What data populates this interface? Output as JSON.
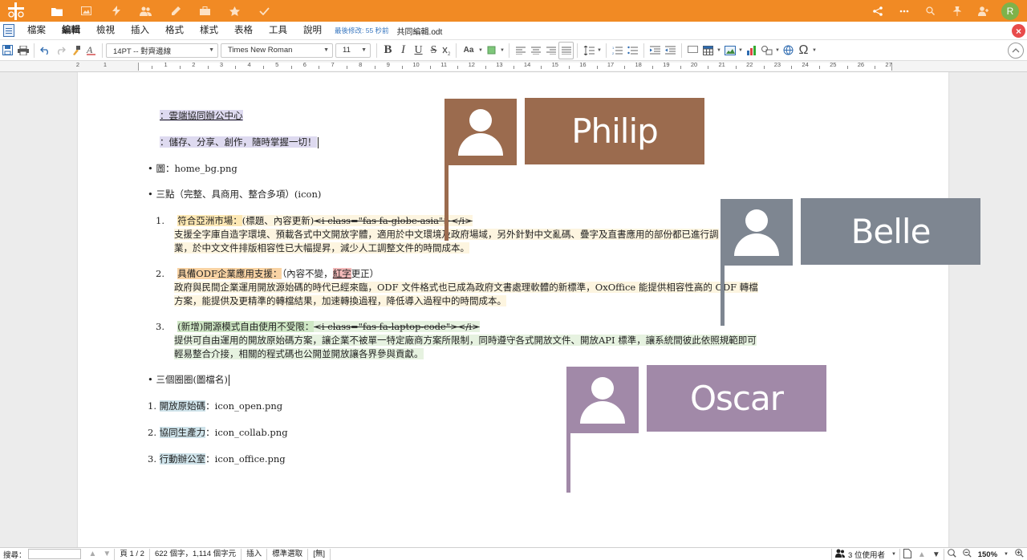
{
  "app": {
    "top_icons": [
      "folder-icon",
      "image-icon",
      "bolt-icon",
      "people-icon",
      "pencil-icon",
      "briefcase-icon",
      "star-icon",
      "check-icon"
    ],
    "right_icons": [
      "share-icon",
      "more-icon",
      "search-icon",
      "pin-icon",
      "user-add-icon"
    ],
    "user_initial": "R"
  },
  "menubar": {
    "items": [
      "檔案",
      "編輯",
      "檢視",
      "插入",
      "格式",
      "樣式",
      "表格",
      "工具",
      "說明"
    ],
    "last_modified": "最後修改: 55 秒前",
    "filename": "共同編輯.odt"
  },
  "toolbar": {
    "paragraph_style": "14PT -- 對齊邊線",
    "font_name": "Times New Roman",
    "font_size": "11",
    "bold": "B",
    "italic": "I",
    "underline": "U",
    "strike": "S",
    "font_case": "Aa",
    "special_char": "Ω"
  },
  "ruler": {
    "left_numbers": [
      "2",
      "1"
    ],
    "numbers": [
      "1",
      "2",
      "3",
      "4",
      "5",
      "6",
      "7",
      "8",
      "9",
      "10",
      "11",
      "12",
      "13",
      "14",
      "15",
      "16",
      "17",
      "18",
      "19",
      "20",
      "21",
      "22",
      "23",
      "24",
      "25",
      "26",
      "27"
    ]
  },
  "document": {
    "line1": "：雲端協同辦公中心",
    "line2": "：儲存、分享、創作，隨時掌握一切！",
    "bullet_bg": "• 圖：home_bg.png",
    "bullet_three": "• 三點（完整、具商用、整合多項）(icon)",
    "item1": {
      "num": "1.",
      "title": "符合亞洲市場：",
      "meta": "(標題、內容更新)",
      "code": "<i class=\"fas fa-globe-asia\"></i>",
      "body1": "支援全字庫自造字環境、預載各式中文開放字體，適用於中文環境及政府場域，另外針對中文亂碼、疊字及直書應用的部份都已進行調",
      "body2": "業，於中文文件排版相容性已大幅提昇，減少人工調整文件的時間成本。"
    },
    "item2": {
      "num": "2.",
      "title": "具備ODF企業應用支援：",
      "meta_a": "（內容不變，",
      "red": "紅字",
      "meta_b": "更正）",
      "body1": "政府與民間企業運用開放源始碼的時代已經來臨，ODF 文件格式也已成為政府文書處理軟體的新標準，OxOffice 能提供相容性高的 ODF 轉檔",
      "body2": "方案，能提供及更精準的轉檔結果，加速轉換過程，降低導入過程中的時間成本。"
    },
    "item3": {
      "num": "3.",
      "title": "(新增)開源模式自由使用不受限：",
      "code": "<i class=\"fas fa-laptop-code\"></i>",
      "body1": "提供可自由運用的開放原始碼方案，讓企業不被單一特定廠商方案所限制，同時遵守各式開放文件、開放API 標準，讓系統間彼此依照規範即可",
      "body2": "輕易整合介接，相關的程式碼也公開並開放讓各界參與貢獻。"
    },
    "bullet_circles": "• 三個圈圈(圖檔名)",
    "files": [
      {
        "num": "1.",
        "label": "開放原始碼",
        "file": "：icon_open.png"
      },
      {
        "num": "2.",
        "label": "協同生產力",
        "file": "：icon_collab.png"
      },
      {
        "num": "3.",
        "label": "行動辦公室",
        "file": "：icon_office.png"
      }
    ]
  },
  "collaborators": [
    {
      "name": "Philip",
      "color": "#9b6b4e"
    },
    {
      "name": "Belle",
      "color": "#7e8691"
    },
    {
      "name": "Oscar",
      "color": "#a189a8"
    }
  ],
  "statusbar": {
    "search_label": "搜尋：",
    "page": "頁 1 / 2",
    "count": "622 個字，1,114 個字元",
    "mode": "插入",
    "selection": "標準選取",
    "bracket": "[無]",
    "users": "3 位使用者",
    "zoom": "150%"
  }
}
